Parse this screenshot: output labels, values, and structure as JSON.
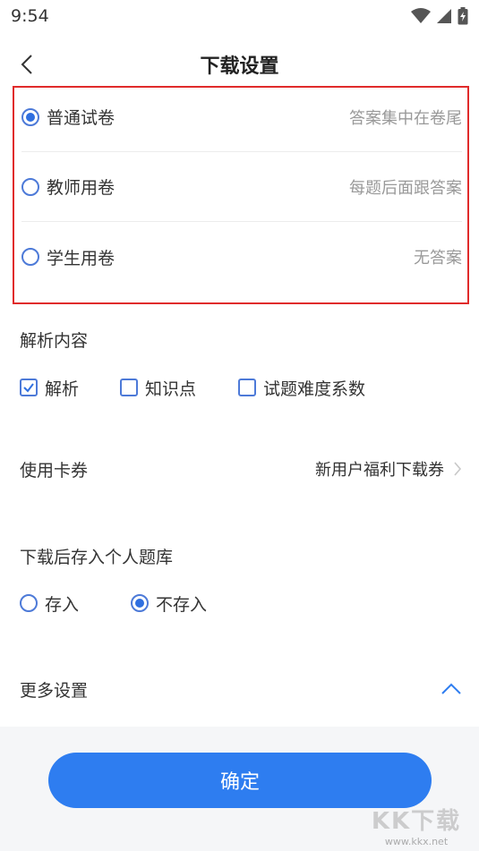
{
  "status_bar": {
    "time": "9:54",
    "icons": [
      "wifi-icon",
      "cellular-icon",
      "battery-charging-icon"
    ]
  },
  "header": {
    "title": "下载设置",
    "back_icon": "chevron-left-icon"
  },
  "paper_types": [
    {
      "label": "普通试卷",
      "desc": "答案集中在卷尾",
      "selected": true
    },
    {
      "label": "教师用卷",
      "desc": "每题后面跟答案",
      "selected": false
    },
    {
      "label": "学生用卷",
      "desc": "无答案",
      "selected": false
    }
  ],
  "analysis": {
    "title": "解析内容",
    "options": [
      {
        "label": "解析",
        "checked": true
      },
      {
        "label": "知识点",
        "checked": false
      },
      {
        "label": "试题难度系数",
        "checked": false
      }
    ]
  },
  "coupon": {
    "label": "使用卡券",
    "value": "新用户福利下载券"
  },
  "save_to_bank": {
    "title": "下载后存入个人题库",
    "options": [
      {
        "label": "存入",
        "selected": false
      },
      {
        "label": "不存入",
        "selected": true
      }
    ]
  },
  "more_settings": {
    "label": "更多设置",
    "icon": "chevron-up-icon"
  },
  "footer": {
    "confirm_label": "确定"
  },
  "watermark": {
    "mark": "KK下载",
    "url": "www.kkx.net"
  },
  "colors": {
    "accent": "#2e7df0",
    "highlight_border": "#e02b2b"
  }
}
